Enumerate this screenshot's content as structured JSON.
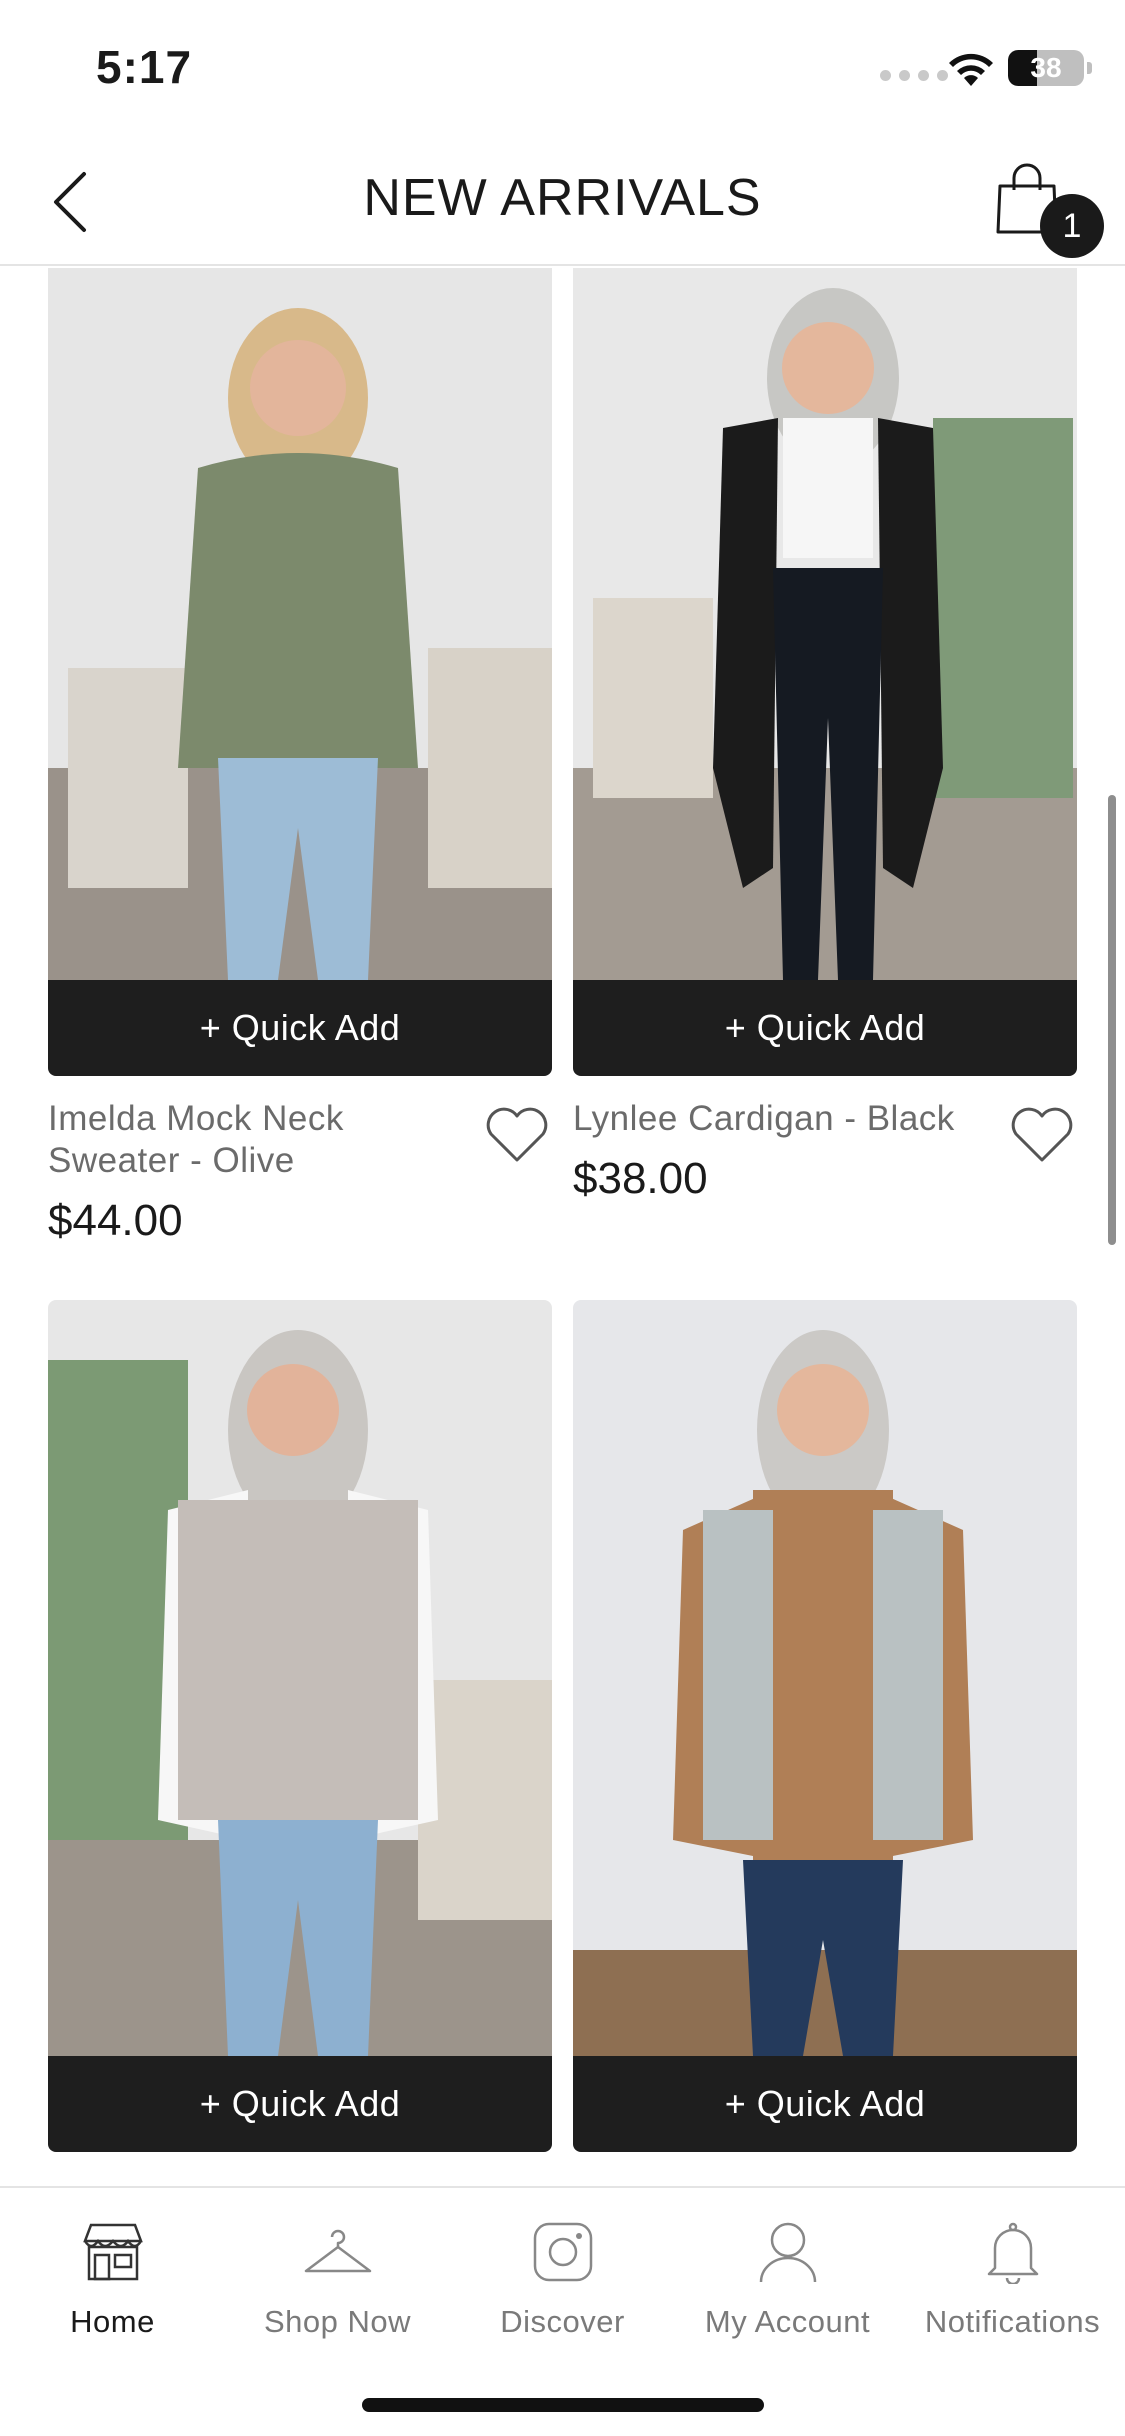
{
  "status_bar": {
    "time": "5:17",
    "battery": "38",
    "battery_level": 0.38
  },
  "header": {
    "title": "NEW ARRIVALS",
    "cart_count": "1"
  },
  "products": [
    {
      "name": "Imelda Mock Neck Sweater - Olive",
      "price": "$44.00",
      "quick_add": "+ Quick Add"
    },
    {
      "name": "Lynlee Cardigan - Black",
      "price": "$38.00",
      "quick_add": "+ Quick Add"
    },
    {
      "name": "",
      "price": "",
      "quick_add": "+ Quick Add"
    },
    {
      "name": "",
      "price": "",
      "quick_add": "+ Quick Add"
    }
  ],
  "tabs": [
    {
      "label": "Home",
      "icon": "storefront-icon",
      "active": true
    },
    {
      "label": "Shop Now",
      "icon": "hanger-icon",
      "active": false
    },
    {
      "label": "Discover",
      "icon": "instagram-icon",
      "active": false
    },
    {
      "label": "My Account",
      "icon": "user-icon",
      "active": false
    },
    {
      "label": "Notifications",
      "icon": "bell-icon",
      "active": false
    }
  ],
  "colors": {
    "primary_dark": "#1e1e1e",
    "muted_text": "#6b6b6b",
    "background": "#ffffff"
  }
}
